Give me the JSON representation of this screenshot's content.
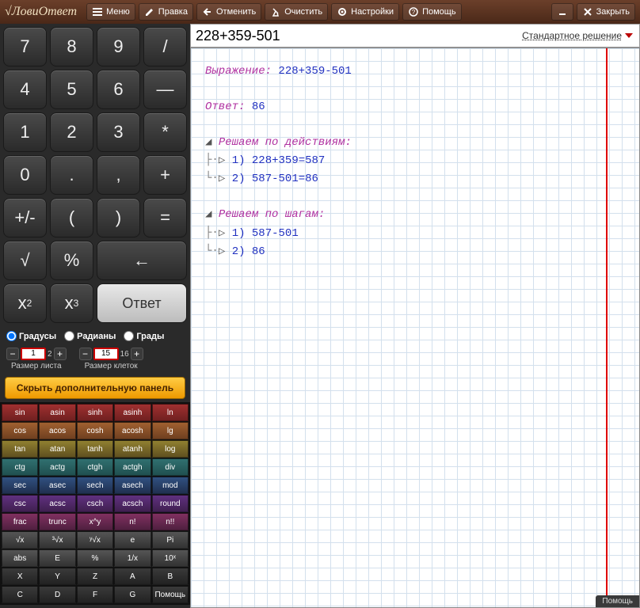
{
  "app_title": "ЛовиОтвет",
  "toolbar": {
    "menu": "Меню",
    "edit": "Правка",
    "undo": "Отменить",
    "clear": "Очистить",
    "settings": "Настройки",
    "help": "Помощь",
    "close": "Закрыть"
  },
  "expression": {
    "value": "228+359-501",
    "mode": "Стандартное решение"
  },
  "keypad": {
    "k7": "7",
    "k8": "8",
    "k9": "9",
    "div": "/",
    "k4": "4",
    "k5": "5",
    "k6": "6",
    "minus": "—",
    "k1": "1",
    "k2": "2",
    "k3": "3",
    "mul": "*",
    "k0": "0",
    "dot": ".",
    "comma": ",",
    "plus": "+",
    "pm": "+/-",
    "lp": "(",
    "rp": ")",
    "eq": "=",
    "sqrt": "√",
    "pct": "%",
    "back": "←",
    "sq": "x",
    "sq_sup": "2",
    "cube": "x",
    "cube_sup": "3",
    "answer": "Ответ"
  },
  "angle": {
    "deg": "Градусы",
    "rad": "Радианы",
    "grad": "Грады",
    "selected": "deg"
  },
  "sizes": {
    "sheet_val": "1",
    "sheet_max": "2",
    "sheet_label": "Размер листа",
    "cell_val": "15",
    "cell_max": "16",
    "cell_label": "Размер клеток"
  },
  "toggle_extra": "Скрыть дополнительную панель",
  "func_rows": [
    {
      "cls": "red",
      "cells": [
        "sin",
        "asin",
        "sinh",
        "asinh",
        "ln"
      ]
    },
    {
      "cls": "orange",
      "cells": [
        "cos",
        "acos",
        "cosh",
        "acosh",
        "lg"
      ]
    },
    {
      "cls": "yellow",
      "cells": [
        "tan",
        "atan",
        "tanh",
        "atanh",
        "log"
      ]
    },
    {
      "cls": "teal",
      "cells": [
        "ctg",
        "actg",
        "ctgh",
        "actgh",
        "div"
      ]
    },
    {
      "cls": "blue",
      "cells": [
        "sec",
        "asec",
        "sech",
        "asech",
        "mod"
      ]
    },
    {
      "cls": "purple",
      "cells": [
        "csc",
        "acsc",
        "csch",
        "acsch",
        "round"
      ]
    },
    {
      "cls": "pink",
      "cells": [
        "frac",
        "trunc",
        "x^y",
        "n!",
        "n!!"
      ]
    },
    {
      "cls": "gray",
      "cells": [
        "√x",
        "³√x",
        "ʸ√x",
        "e",
        "Pi"
      ]
    },
    {
      "cls": "gray",
      "cells": [
        "abs",
        "E",
        "%",
        "1/x",
        "10ˣ"
      ]
    },
    {
      "cls": "dark",
      "cells": [
        "X",
        "Y",
        "Z",
        "A",
        "B"
      ]
    },
    {
      "cls": "dark",
      "cells": [
        "C",
        "D",
        "F",
        "G",
        "Помощь"
      ]
    }
  ],
  "solution": {
    "expr_label": "Выражение:",
    "expr_val": "228+359-501",
    "ans_label": "Ответ:",
    "ans_val": "86",
    "by_actions_label": "Решаем по действиям:",
    "action1": "1) 228+359=587",
    "action2": "2) 587-501=86",
    "by_steps_label": "Решаем по шагам:",
    "step1": "1) 587-501",
    "step2": "2) 86"
  },
  "help_tab": "Помощь"
}
